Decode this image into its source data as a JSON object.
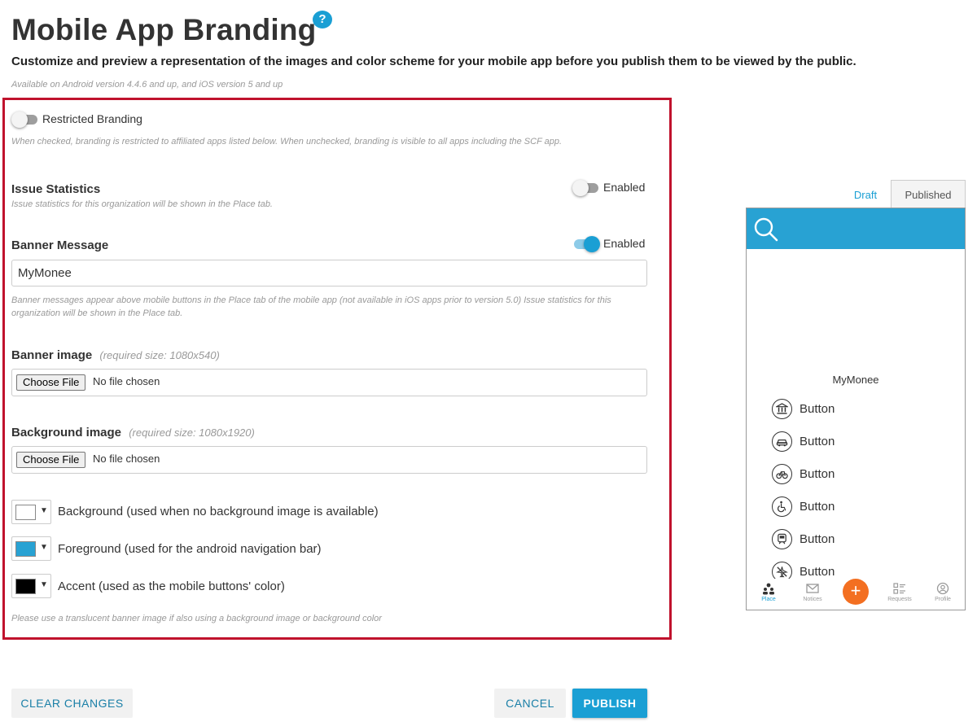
{
  "header": {
    "title": "Mobile App Branding",
    "help_glyph": "?",
    "subtitle": "Customize and preview a representation of the images and color scheme for your mobile app before you publish them to be viewed by the public.",
    "availability": "Available on Android version 4.4.6 and up, and iOS version 5 and up"
  },
  "settings": {
    "restricted_branding": {
      "label": "Restricted Branding",
      "checked": false,
      "help": "When checked, branding is restricted to affiliated apps listed below. When unchecked, branding is visible to all apps including the SCF app."
    },
    "issue_statistics": {
      "label": "Issue Statistics",
      "toggle_label": "Enabled",
      "enabled": false,
      "help": "Issue statistics for this organization will be shown in the Place tab."
    },
    "banner_message": {
      "label": "Banner Message",
      "toggle_label": "Enabled",
      "enabled": true,
      "value": "MyMonee",
      "help_line1": "Banner messages appear above mobile buttons in the Place tab of the mobile app (not available in iOS apps prior to version 5.0) Issue statistics for this",
      "help_line2": "organization will be shown in the Place tab."
    },
    "banner_image": {
      "label": "Banner image",
      "required": "(required size: 1080x540)",
      "choose_label": "Choose File",
      "file_status": "No file chosen"
    },
    "background_image": {
      "label": "Background image",
      "required": "(required size: 1080x1920)",
      "choose_label": "Choose File",
      "file_status": "No file chosen"
    },
    "colors": [
      {
        "label": "Background (used when no background image is available)",
        "color": "#ffffff"
      },
      {
        "label": "Foreground (used for the android navigation bar)",
        "color": "#28a2d3"
      },
      {
        "label": "Accent (used as the mobile buttons' color)",
        "color": "#000000"
      }
    ],
    "dropdown_glyph": "▼",
    "footer_note": "Please use a translucent banner image if also using a background image or background color"
  },
  "actions": {
    "clear": "CLEAR CHANGES",
    "cancel": "CANCEL",
    "publish": "PUBLISH"
  },
  "preview": {
    "tabs": {
      "draft": "Draft",
      "published": "Published"
    },
    "banner_text": "MyMonee",
    "buttons": [
      {
        "label": "Button",
        "icon": "bank-icon"
      },
      {
        "label": "Button",
        "icon": "car-icon"
      },
      {
        "label": "Button",
        "icon": "bicycle-icon"
      },
      {
        "label": "Button",
        "icon": "wheelchair-icon"
      },
      {
        "label": "Button",
        "icon": "train-icon"
      },
      {
        "label": "Button",
        "icon": "no-plane-icon"
      }
    ],
    "nav": {
      "place": "Place",
      "notices": "Notices",
      "fab": "+",
      "requests": "Requests",
      "profile": "Profile"
    },
    "header_color": "#28a2d3",
    "fab_color": "#f36f21"
  },
  "colors": {
    "accent": "#1a9fd4",
    "panel_border": "#c0122d"
  }
}
